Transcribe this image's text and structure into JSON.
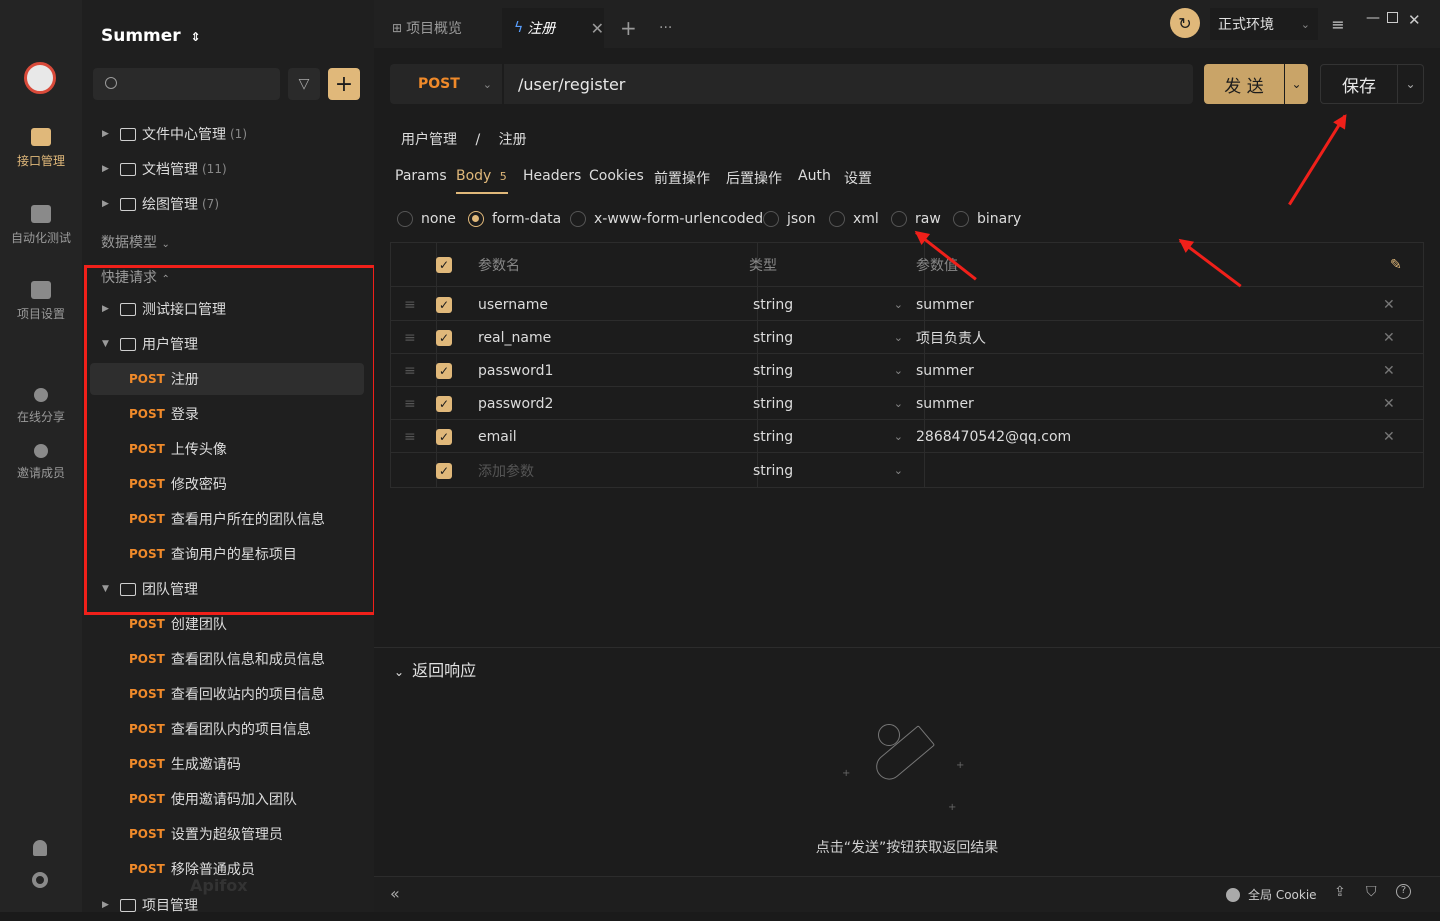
{
  "workspace": {
    "name": "Summer"
  },
  "rail": [
    {
      "label": "接口管理",
      "icon": "api-icon",
      "active": true
    },
    {
      "label": "自动化测试",
      "icon": "test-icon"
    },
    {
      "label": "项目设置",
      "icon": "settings-icon"
    },
    {
      "label": "在线分享",
      "icon": "share-icon"
    },
    {
      "label": "邀请成员",
      "icon": "invite-icon"
    }
  ],
  "sidebar": {
    "folders_top": [
      {
        "label": "文件中心管理",
        "count": "(1)"
      },
      {
        "label": "文档管理",
        "count": "(11)"
      },
      {
        "label": "绘图管理",
        "count": "(7)"
      }
    ],
    "data_model": "数据模型",
    "quick_request": "快捷请求",
    "test_folder": "测试接口管理",
    "user_folder": "用户管理",
    "user_endpoints": [
      {
        "method": "POST",
        "name": "注册"
      },
      {
        "method": "POST",
        "name": "登录"
      },
      {
        "method": "POST",
        "name": "上传头像"
      },
      {
        "method": "POST",
        "name": "修改密码"
      },
      {
        "method": "POST",
        "name": "查看用户所在的团队信息"
      },
      {
        "method": "POST",
        "name": "查询用户的星标项目"
      }
    ],
    "team_folder": "团队管理",
    "team_endpoints": [
      {
        "method": "POST",
        "name": "创建团队"
      },
      {
        "method": "POST",
        "name": "查看团队信息和成员信息"
      },
      {
        "method": "POST",
        "name": "查看回收站内的项目信息"
      },
      {
        "method": "POST",
        "name": "查看团队内的项目信息"
      },
      {
        "method": "POST",
        "name": "生成邀请码"
      },
      {
        "method": "POST",
        "name": "使用邀请码加入团队"
      },
      {
        "method": "POST",
        "name": "设置为超级管理员"
      },
      {
        "method": "POST",
        "name": "移除普通成员"
      }
    ],
    "project_folder": "项目管理",
    "watermark": "Apifox"
  },
  "tabs": {
    "overview": "项目概览",
    "active": "注册"
  },
  "env": {
    "label": "正式环境"
  },
  "request": {
    "method": "POST",
    "url": "/user/register",
    "send": "发 送",
    "save": "保存"
  },
  "breadcrumb": {
    "parent": "用户管理",
    "sep": "/",
    "current": "注册"
  },
  "subtabs": [
    {
      "label": "Params"
    },
    {
      "label": "Body",
      "badge": "5",
      "active": true
    },
    {
      "label": "Headers"
    },
    {
      "label": "Cookies"
    },
    {
      "label": "前置操作"
    },
    {
      "label": "后置操作"
    },
    {
      "label": "Auth"
    },
    {
      "label": "设置"
    }
  ],
  "body_types": [
    "none",
    "form-data",
    "x-www-form-urlencoded",
    "json",
    "xml",
    "raw",
    "binary"
  ],
  "body_selected": "form-data",
  "table": {
    "headers": {
      "name": "参数名",
      "type": "类型",
      "value": "参数值"
    },
    "rows": [
      {
        "name": "username",
        "type": "string",
        "value": "summer"
      },
      {
        "name": "real_name",
        "type": "string",
        "value": "项目负责人"
      },
      {
        "name": "password1",
        "type": "string",
        "value": "summer"
      },
      {
        "name": "password2",
        "type": "string",
        "value": "summer"
      },
      {
        "name": "email",
        "type": "string",
        "value": "2868470542@qq.com"
      }
    ],
    "add_placeholder": "添加参数",
    "add_type": "string"
  },
  "response": {
    "title": "返回响应",
    "hint": "点击“发送”按钮获取返回结果"
  },
  "footer": {
    "cookie": "全局 Cookie"
  },
  "colors": {
    "accent": "#e0b87a",
    "method": "#f08a2a",
    "annotation": "#f0201a"
  }
}
